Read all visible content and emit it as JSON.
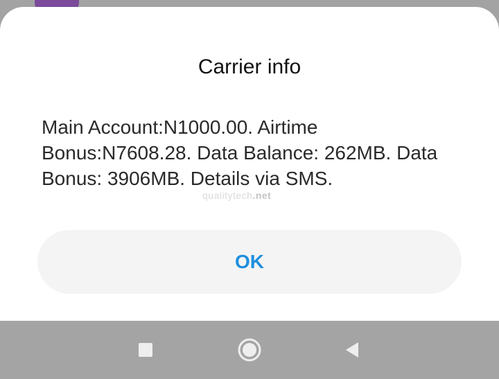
{
  "dialog": {
    "title": "Carrier info",
    "message": "Main Account:N1000.00. Airtime Bonus:N7608.28. Data Balance: 262MB. Data Bonus: 3906MB. Details via SMS.",
    "ok_label": "OK"
  },
  "watermark": {
    "text": "qualitytech",
    "suffix": ".net"
  },
  "navbar": {
    "icons": [
      "recents-square-icon",
      "home-circle-icon",
      "back-triangle-icon"
    ]
  },
  "colors": {
    "accent": "#1e8fde",
    "dialog_bg": "#ffffff",
    "button_bg": "#f4f4f4",
    "navbar_bg": "#a4a4a4",
    "overlay_bg": "#a3a3a3"
  }
}
